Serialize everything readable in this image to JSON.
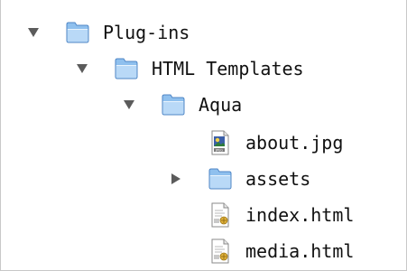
{
  "tree": {
    "items": [
      {
        "label": "Plug-ins",
        "type": "folder",
        "expanded": true,
        "depth": 0,
        "icon": "folder-icon"
      },
      {
        "label": "HTML Templates",
        "type": "folder",
        "expanded": true,
        "depth": 1,
        "icon": "folder-icon"
      },
      {
        "label": "Aqua",
        "type": "folder",
        "expanded": true,
        "depth": 2,
        "icon": "folder-icon"
      },
      {
        "label": "about.jpg",
        "type": "file",
        "depth": 3,
        "icon": "jpg-file-icon"
      },
      {
        "label": "assets",
        "type": "folder",
        "expanded": false,
        "depth": 3,
        "icon": "folder-icon"
      },
      {
        "label": "index.html",
        "type": "file",
        "depth": 3,
        "icon": "html-file-icon"
      },
      {
        "label": "media.html",
        "type": "file",
        "depth": 3,
        "icon": "html-file-icon"
      }
    ]
  },
  "colors": {
    "folder_top": "#d7e9fb",
    "folder_body": "#8fc0ee",
    "folder_edge": "#4f86c6",
    "triangle": "#5b5b5b",
    "text": "#111111"
  }
}
